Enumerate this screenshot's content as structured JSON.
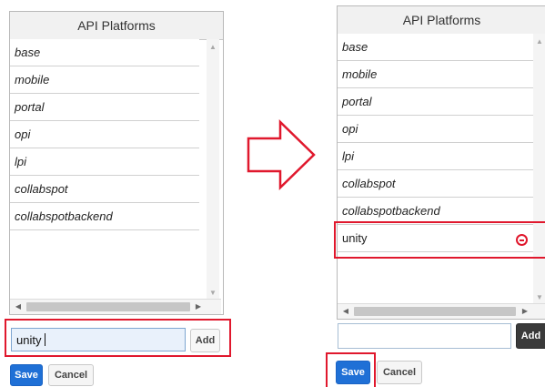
{
  "list_header": "API Platforms",
  "items": [
    "base",
    "mobile",
    "portal",
    "opi",
    "lpi",
    "collabspot",
    "collabspotbackend"
  ],
  "new_item": "unity",
  "before": {
    "input_value": "unity"
  },
  "after": {
    "input_value": ""
  },
  "buttons": {
    "add": "Add",
    "save": "Save",
    "cancel": "Cancel"
  },
  "colors": {
    "highlight": "#e0182d",
    "save": "#1f70d6",
    "add_dark": "#3a3a3a"
  }
}
